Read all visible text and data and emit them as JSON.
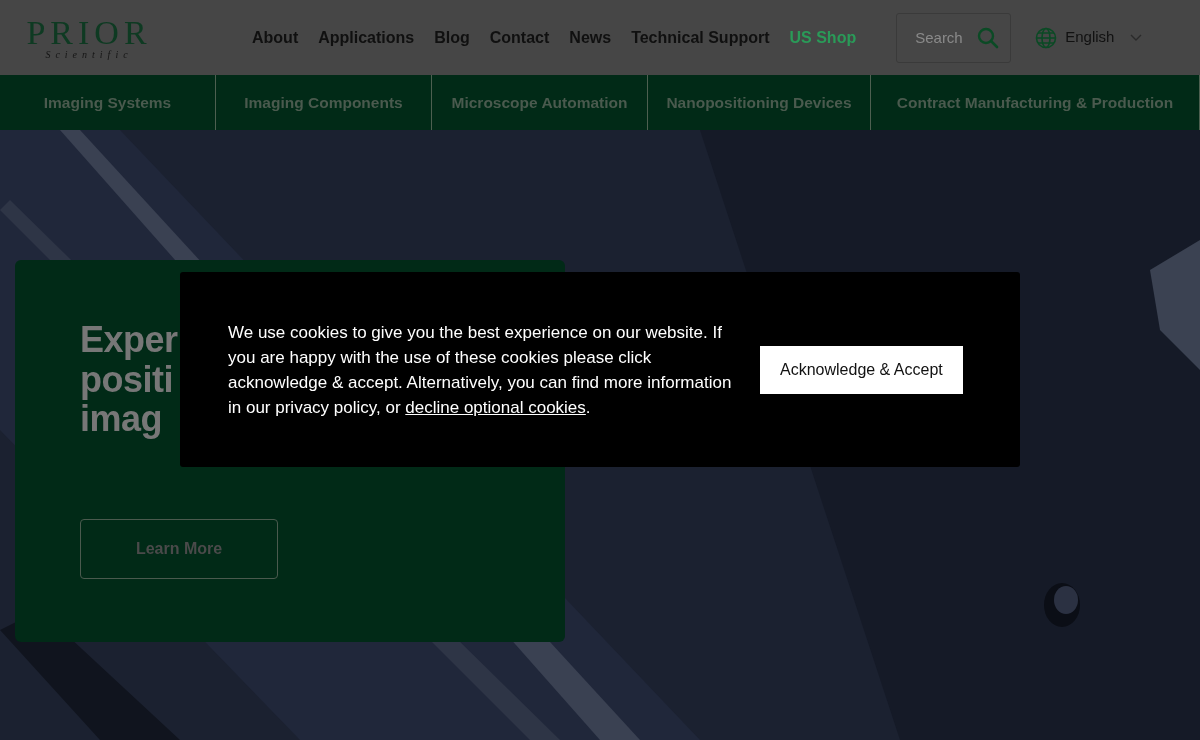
{
  "header": {
    "logo": {
      "name": "PRIOR",
      "tagline": "Scientific"
    },
    "nav": [
      {
        "label": "About",
        "highlighted": false
      },
      {
        "label": "Applications",
        "highlighted": false
      },
      {
        "label": "Blog",
        "highlighted": false
      },
      {
        "label": "Contact",
        "highlighted": false
      },
      {
        "label": "News",
        "highlighted": false
      },
      {
        "label": "Technical Support",
        "highlighted": false
      },
      {
        "label": "US Shop",
        "highlighted": true
      }
    ],
    "search": {
      "placeholder": "Search"
    },
    "language": "English"
  },
  "categories": [
    "Imaging Systems",
    "Imaging Components",
    "Microscope Automation",
    "Nanopositioning Devices",
    "Contract Manufacturing & Production"
  ],
  "hero": {
    "headline_lines": [
      "Exper",
      "positi",
      "imag"
    ],
    "button": "Learn More"
  },
  "cookie_banner": {
    "text": "We use cookies to give you the best experience on our website. If you are happy with the use of these cookies please click acknowledge & accept. Alternatively, you can find more information in our privacy policy, or ",
    "link": "decline optional cookies",
    "text_end": ".",
    "button": "Acknowledge & Accept"
  }
}
